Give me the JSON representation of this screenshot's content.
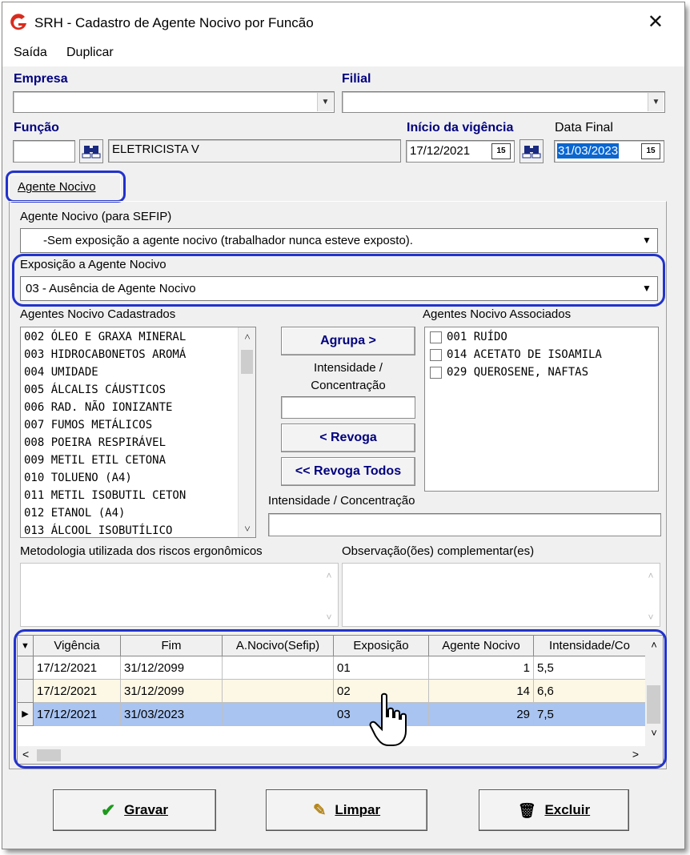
{
  "window": {
    "title": "SRH - Cadastro de Agente Nocivo por Funcão",
    "close_glyph": "✕"
  },
  "menu": [
    "Saída",
    "Duplicar"
  ],
  "header": {
    "empresa_label": "Empresa",
    "filial_label": "Filial",
    "funcao_label": "Função",
    "funcao_code": "",
    "funcao_name": "ELETRICISTA V",
    "inicio_label": "Início da vigência",
    "inicio_value": "17/12/2021",
    "data_final_label": "Data Final",
    "data_final_value": "31/03/2023",
    "calendar_glyph": "15"
  },
  "tab": {
    "label": "Agente Nocivo"
  },
  "sefip": {
    "label": "Agente Nocivo (para SEFIP)",
    "value": "-Sem exposição a agente nocivo (trabalhador nunca esteve exposto)."
  },
  "exposicao": {
    "label": "Exposição a Agente Nocivo",
    "value": "03 - Ausência de Agente Nocivo"
  },
  "cadastrados": {
    "label": "Agentes Nocivo Cadastrados",
    "items": [
      "002 ÓLEO E GRAXA MINERAL",
      "003 HIDROCABONETOS AROMÁ",
      "004 UMIDADE",
      "005 ÁLCALIS CÁUSTICOS",
      "006 RAD. NÃO IONIZANTE",
      "007 FUMOS METÁLICOS",
      "008 POEIRA RESPIRÁVEL",
      "009 METIL ETIL CETONA",
      "010 TOLUENO (A4)",
      "011 METIL ISOBUTIL CETON",
      "012 ETANOL (A4)",
      "013 ÁLCOOL ISOBUTÍLICO"
    ]
  },
  "middle": {
    "agrupa": "Agrupa >",
    "intensidade_label_1": "Intensidade /",
    "intensidade_label_2": "Concentração",
    "revoga": "< Revoga",
    "revoga_todos": "<< Revoga Todos"
  },
  "associados": {
    "label": "Agentes Nocivo Associados",
    "items": [
      "001 RUÍDO",
      "014 ACETATO DE ISOAMILA",
      "029 QUEROSENE, NAFTAS"
    ]
  },
  "intensidade_field_label": "Intensidade / Concentração",
  "metodologia_label": "Metodologia utilizada dos riscos ergonômicos",
  "observacao_label": "Observação(ões) complementar(es)",
  "grid": {
    "columns": [
      "Vigência",
      "Fim",
      "A.Nocivo(Sefip)",
      "Exposição",
      "Agente Nocivo",
      "Intensidade/Co"
    ],
    "rows": [
      [
        "17/12/2021",
        "31/12/2099",
        "",
        "01",
        "1",
        "5,5"
      ],
      [
        "17/12/2021",
        "31/12/2099",
        "",
        "02",
        "14",
        "6,6"
      ],
      [
        "17/12/2021",
        "31/03/2023",
        "",
        "03",
        "29",
        "7,5"
      ]
    ],
    "selected_row": 2
  },
  "buttons": {
    "gravar": "Gravar",
    "limpar": "Limpar",
    "excluir": "Excluir"
  },
  "colors": {
    "highlight": "#2233cc",
    "label_blue": "#00007f",
    "selected_row": "#a9c4f0",
    "alt_row": "#fdf8e6"
  }
}
